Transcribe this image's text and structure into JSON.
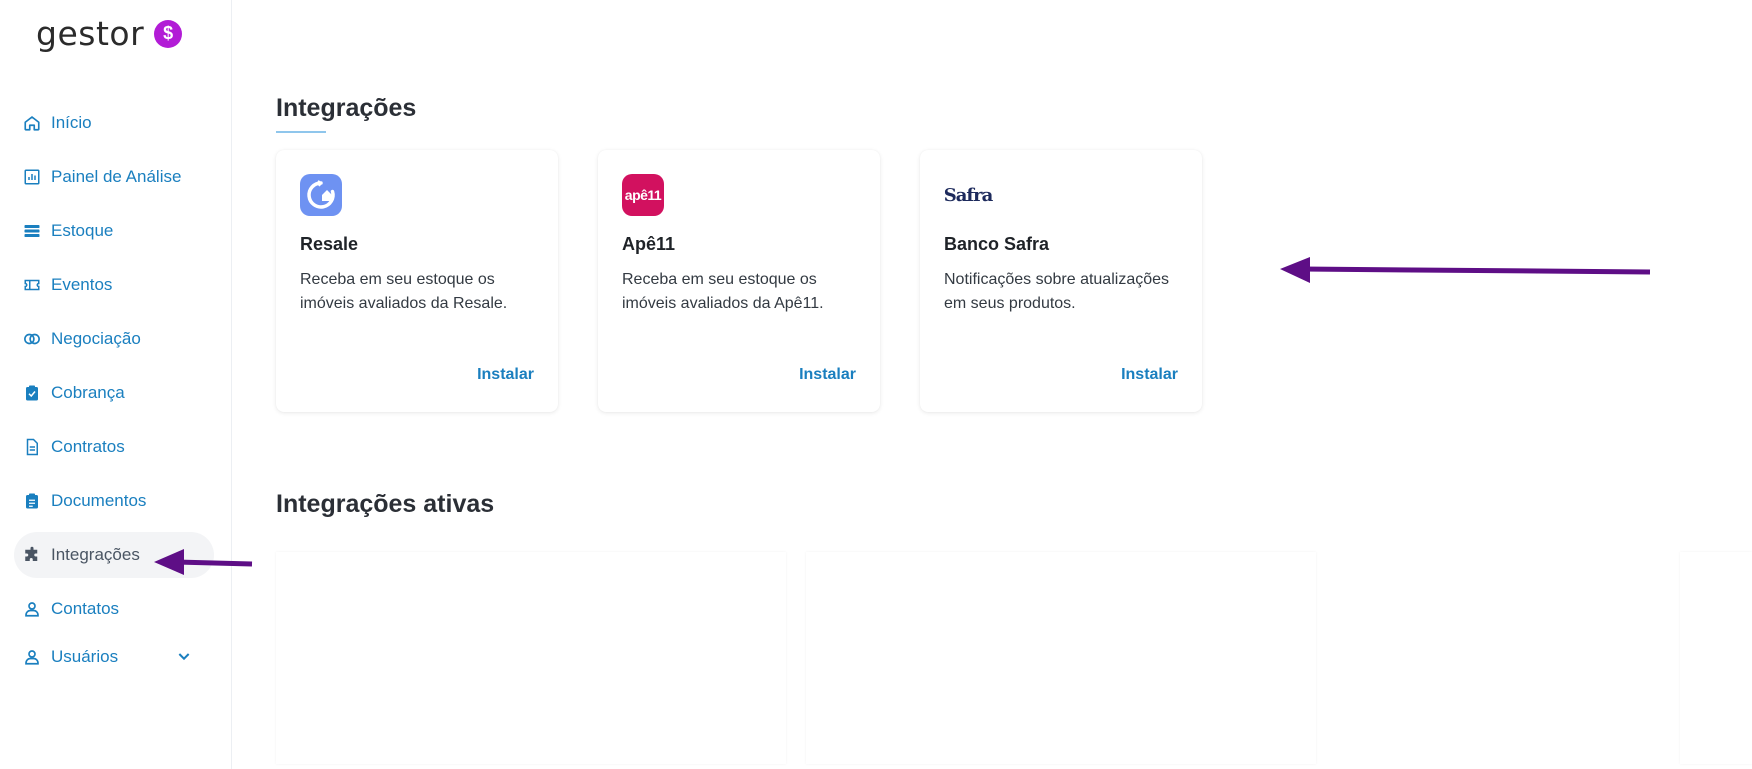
{
  "app": {
    "logo_text": "gestor",
    "logo_symbol": "$",
    "brand_color": "#b21cd6"
  },
  "sidebar": {
    "items": [
      {
        "label": "Início",
        "icon": "home-icon"
      },
      {
        "label": "Painel de Análise",
        "icon": "chart-icon"
      },
      {
        "label": "Estoque",
        "icon": "list-icon"
      },
      {
        "label": "Eventos",
        "icon": "ticket-icon"
      },
      {
        "label": "Negociação",
        "icon": "rings-icon"
      },
      {
        "label": "Cobrança",
        "icon": "clipboard-check-icon"
      },
      {
        "label": "Contratos",
        "icon": "document-icon"
      },
      {
        "label": "Documentos",
        "icon": "clipboard-list-icon"
      },
      {
        "label": "Integrações",
        "icon": "puzzle-icon",
        "active": true
      },
      {
        "label": "Contatos",
        "icon": "user-icon"
      },
      {
        "label": "Usuários",
        "icon": "user-icon",
        "expandable": true
      }
    ]
  },
  "main": {
    "title": "Integrações",
    "integrations": [
      {
        "name": "Resale",
        "description": "Receba em seu estoque os imóveis avaliados da Resale.",
        "action": "Instalar",
        "logo": "resale-logo"
      },
      {
        "name": "Apê11",
        "description": "Receba em seu estoque os imóveis avaliados da Apê11.",
        "action": "Instalar",
        "logo": "ape11-logo",
        "logo_text": "apê11"
      },
      {
        "name": "Banco Safra",
        "description": "Notificações sobre atualizações em seus produtos.",
        "action": "Instalar",
        "logo": "safra-logo",
        "logo_text": "Safra"
      }
    ],
    "active_title": "Integrações ativas"
  },
  "colors": {
    "accent": "#1a7fbf",
    "annotation_arrow": "#5e0e86"
  }
}
